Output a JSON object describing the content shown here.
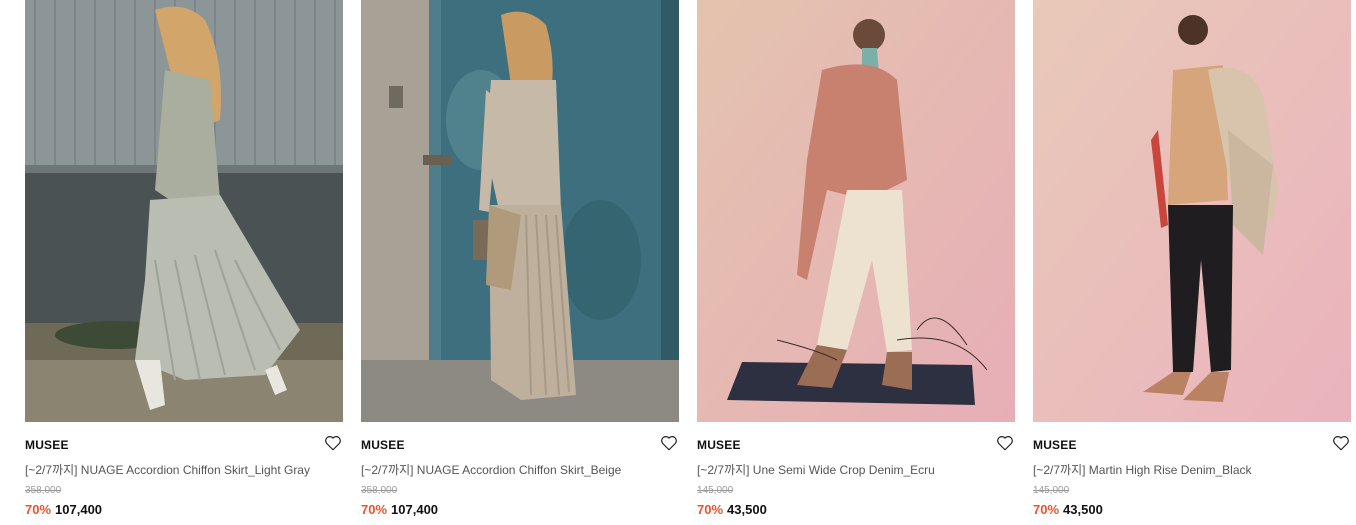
{
  "colors": {
    "discount": "#f0522a",
    "text": "#111111",
    "muted": "#555555",
    "strike": "#9a9a9a"
  },
  "products": [
    {
      "brand": "MUSEE",
      "name": "[~2/7까지] NUAGE Accordion Chiffon Skirt_Light Gray",
      "original_price": "358,000",
      "discount": "70%",
      "price": "107,400",
      "wishlist_icon": "heart-outline-icon"
    },
    {
      "brand": "MUSEE",
      "name": "[~2/7까지] NUAGE Accordion Chiffon Skirt_Beige",
      "original_price": "358,000",
      "discount": "70%",
      "price": "107,400",
      "wishlist_icon": "heart-outline-icon"
    },
    {
      "brand": "MUSEE",
      "name": "[~2/7까지] Une Semi Wide Crop Denim_Ecru",
      "original_price": "145,000",
      "discount": "70%",
      "price": "43,500",
      "wishlist_icon": "heart-outline-icon"
    },
    {
      "brand": "MUSEE",
      "name": "[~2/7까지] Martin High Rise Denim_Black",
      "original_price": "145,000",
      "discount": "70%",
      "price": "43,500",
      "wishlist_icon": "heart-outline-icon"
    }
  ]
}
